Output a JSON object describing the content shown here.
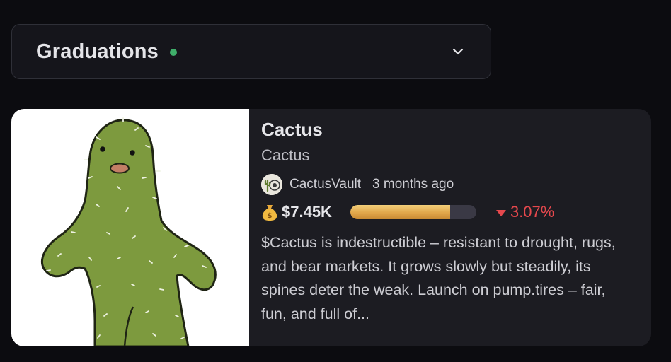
{
  "filter": {
    "label": "Graduations",
    "status_color": "#3fae6a",
    "chevron_icon": "chevron-down-icon"
  },
  "token_card": {
    "name": "Cactus",
    "ticker": "Cactus",
    "creator": {
      "username": "CactusVault",
      "avatar_icon": "cactus-avatar-icon"
    },
    "created": "3 months ago",
    "market_cap_icon": "money-bag-icon",
    "market_cap": "$7.45K",
    "bonding_progress_fraction": 0.79,
    "change_direction": "down",
    "change": "3.07%",
    "change_color": "#e5484d",
    "description": "$Cactus is indestructible – resistant to drought, rugs, and bear markets. It grows slowly but steadily, its spines deter the weak. Launch on pump.tires – fair, fun, and full of..."
  }
}
